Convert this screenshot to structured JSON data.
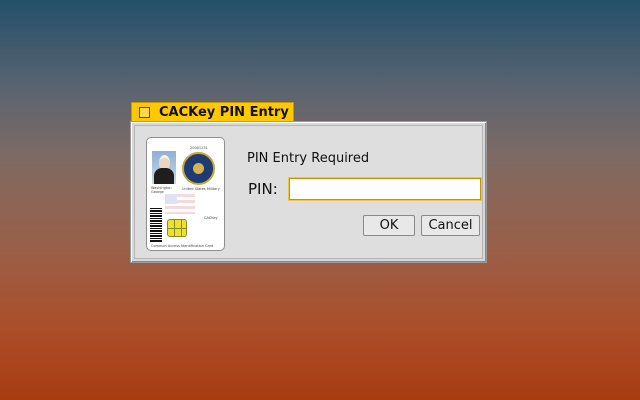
{
  "window": {
    "title": "CACKey PIN Entry",
    "icon": "window-menu-icon"
  },
  "card": {
    "header_text": "20001231",
    "name_text": "Washington\nGeorge",
    "affiliation_text": "United States Military",
    "brand_text": "CACKey",
    "footer_text": "Common Access Identification Card"
  },
  "dialog": {
    "prompt": "PIN Entry Required",
    "pin_label": "PIN:",
    "pin_value": "",
    "ok_label": "OK",
    "cancel_label": "Cancel"
  },
  "colors": {
    "titlebar": "#ffc800",
    "input_focus_border": "#c79200",
    "background_top": "#23506a",
    "background_bottom": "#a83c12"
  }
}
